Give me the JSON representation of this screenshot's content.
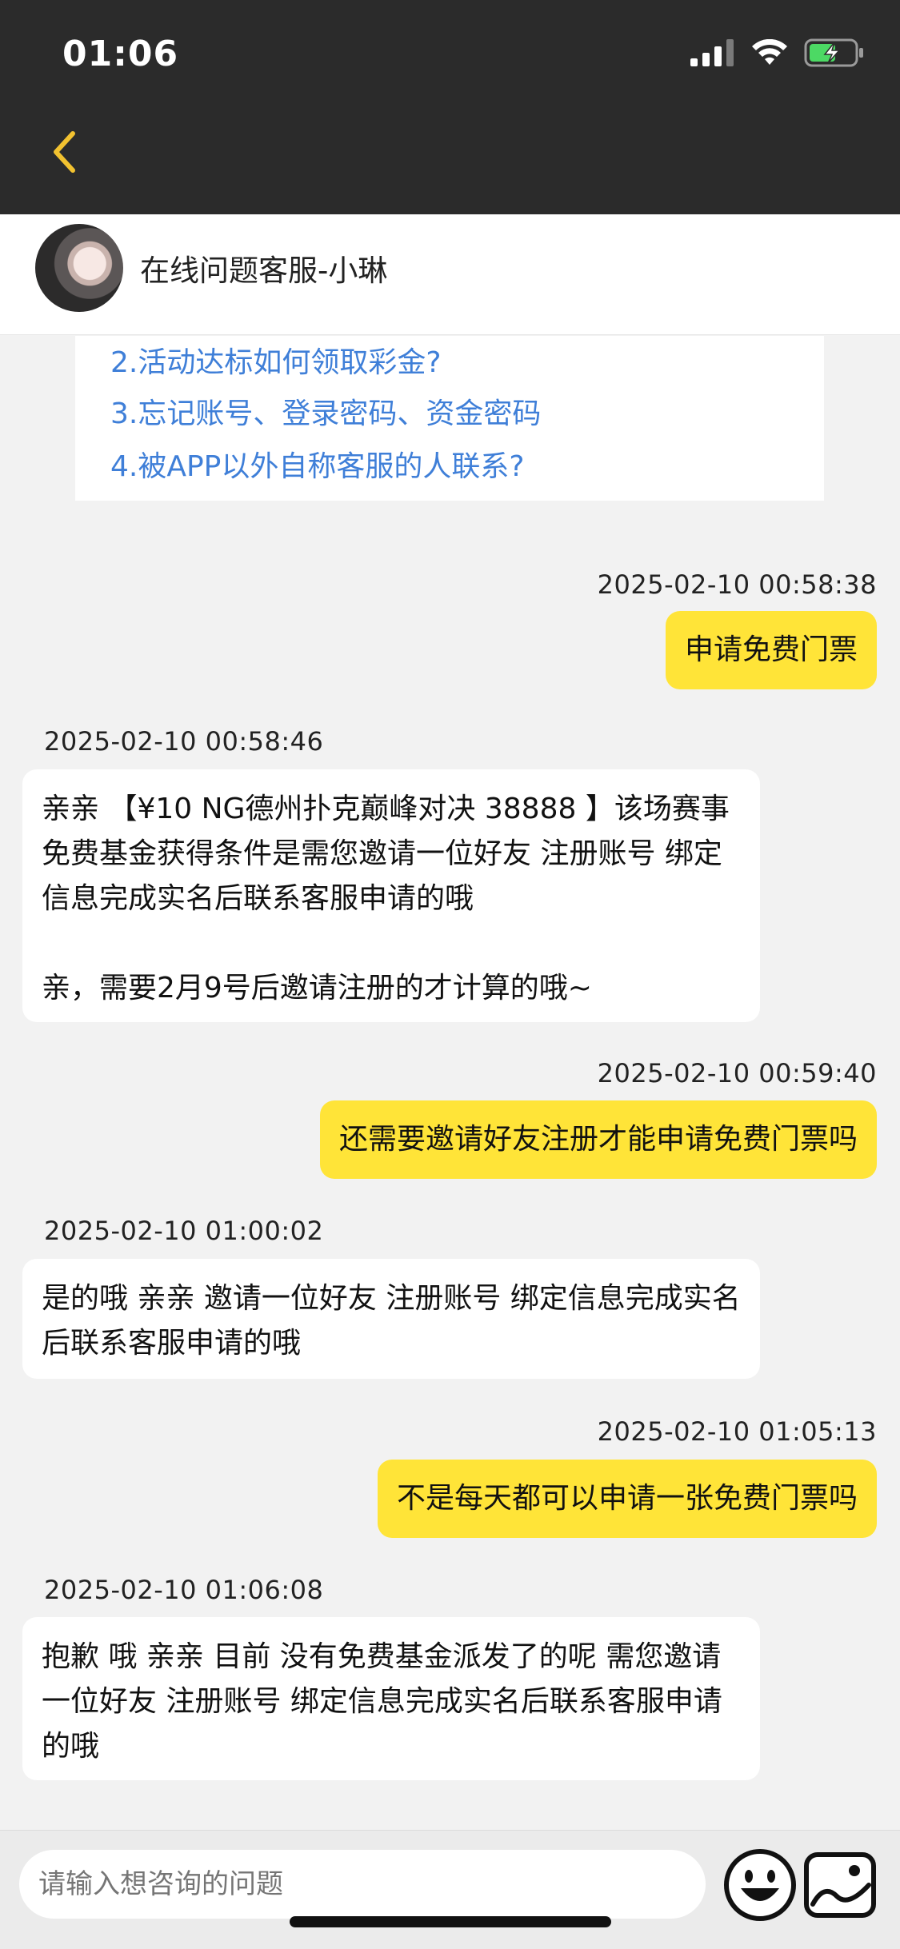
{
  "status_bar": {
    "time": "01:06"
  },
  "header": {
    "title": "在线问题客服-小琳"
  },
  "faq": {
    "items": [
      "2.活动达标如何领取彩金?",
      "3.忘记账号、登录密码、资金密码",
      "4.被APP以外自称客服的人联系?"
    ]
  },
  "messages": [
    {
      "sender": "me",
      "time": "2025-02-10 00:58:38",
      "text": "申请免费门票"
    },
    {
      "sender": "agent",
      "time": "2025-02-10 00:58:46",
      "text": "亲亲 【¥10 NG德州扑克巅峰对决 38888 】该场赛事免费基金获得条件是需您邀请一位好友 注册账号 绑定信息完成实名后联系客服申请的哦\n\n亲，需要2月9号后邀请注册的才计算的哦~"
    },
    {
      "sender": "me",
      "time": "2025-02-10 00:59:40",
      "text": "还需要邀请好友注册才能申请免费门票吗"
    },
    {
      "sender": "agent",
      "time": "2025-02-10 01:00:02",
      "text": "是的哦 亲亲 邀请一位好友 注册账号 绑定信息完成实名后联系客服申请的哦"
    },
    {
      "sender": "me",
      "time": "2025-02-10 01:05:13",
      "text": "不是每天都可以申请一张免费门票吗"
    },
    {
      "sender": "agent",
      "time": "2025-02-10 01:06:08",
      "text": "抱歉 哦 亲亲 目前 没有免费基金派发了的呢 需您邀请一位好友 注册账号 绑定信息完成实名后联系客服申请的哦"
    }
  ],
  "input": {
    "placeholder": "请输入想咨询的问题"
  },
  "colors": {
    "accent": "#ffe438",
    "link": "#3f7fd8",
    "topbar": "#2b2b2b"
  }
}
